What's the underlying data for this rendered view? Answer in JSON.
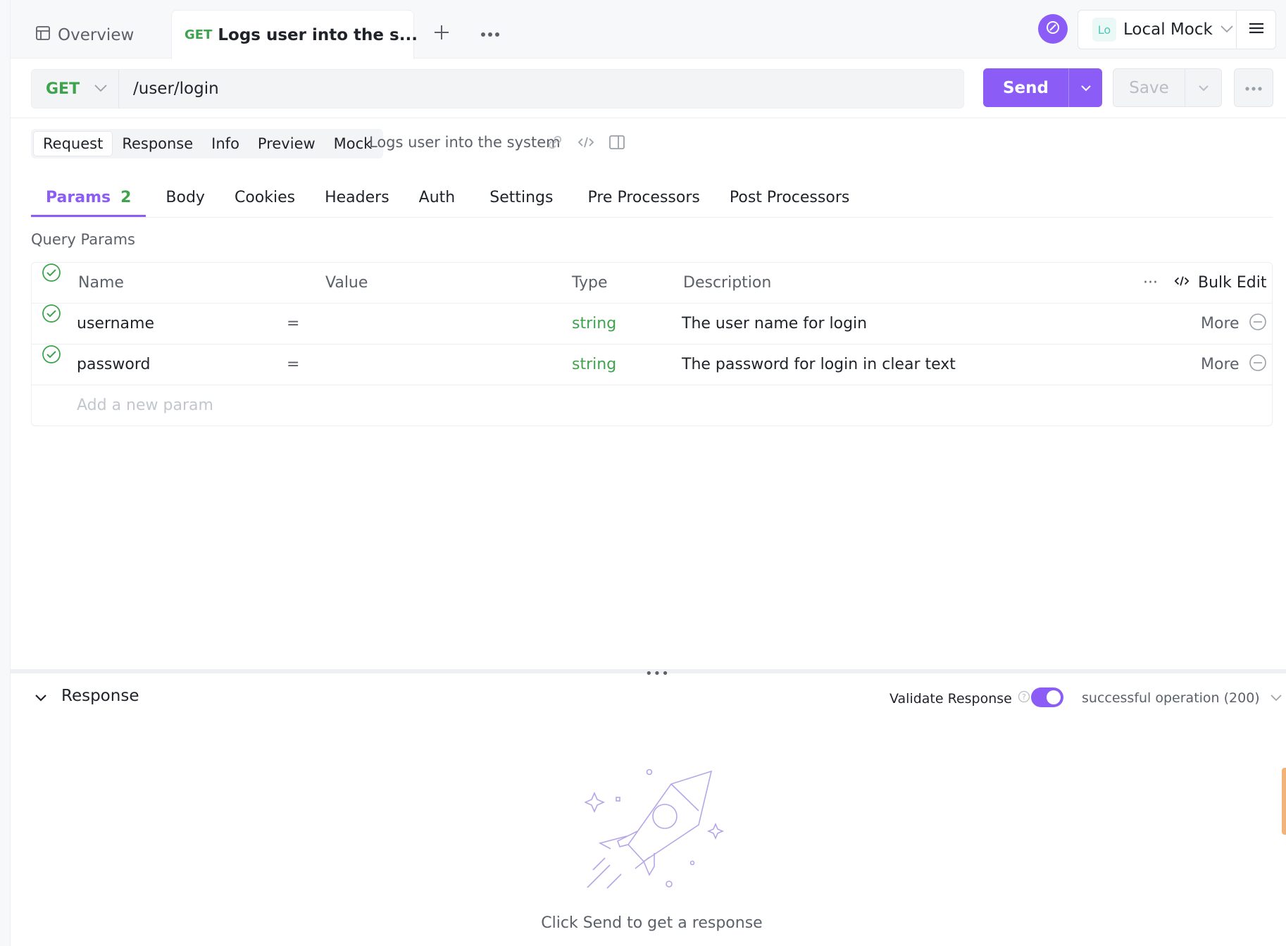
{
  "tabs": {
    "overview_label": "Overview",
    "active_method": "GET",
    "active_title": "Logs user into the s..."
  },
  "environment": {
    "badge": "Lo",
    "label": "Local Mock"
  },
  "request": {
    "method": "GET",
    "url": "/user/login",
    "send_label": "Send",
    "save_label": "Save"
  },
  "modes": [
    "Request",
    "Response",
    "Info",
    "Preview",
    "Mock"
  ],
  "summary": "Logs user into the system",
  "subtabs": {
    "params_label": "Params",
    "params_count": "2",
    "body": "Body",
    "cookies": "Cookies",
    "headers": "Headers",
    "auth": "Auth",
    "settings": "Settings",
    "pre": "Pre Processors",
    "post": "Post Processors"
  },
  "query_params": {
    "title": "Query Params",
    "headers": {
      "name": "Name",
      "value": "Value",
      "type": "Type",
      "description": "Description",
      "more_dots": "···",
      "bulk_edit": "Bulk Edit"
    },
    "rows": [
      {
        "name": "username",
        "eq": "=",
        "type": "string",
        "description": "The user name for login",
        "more": "More"
      },
      {
        "name": "password",
        "eq": "=",
        "type": "string",
        "description": "The password for login in clear text",
        "more": "More"
      }
    ],
    "add_placeholder": "Add a new param"
  },
  "response": {
    "title": "Response",
    "validate_label": "Validate Response",
    "validate_on": true,
    "status_option": "successful operation (200)",
    "empty_text": "Click Send to get a response"
  },
  "colors": {
    "accent": "#8b5cf6",
    "method_get": "#3ea34d",
    "type_string": "#3ea34d"
  }
}
